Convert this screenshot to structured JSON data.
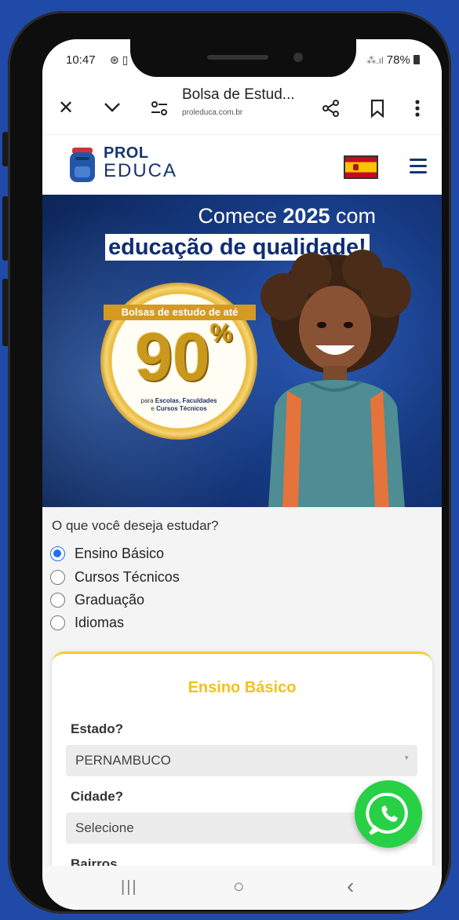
{
  "status_bar": {
    "time": "10:47",
    "status_icons": "⊛ ▯",
    "battery": "78%",
    "signal": "⁂.ıl"
  },
  "browser": {
    "close_icon": "close-icon",
    "dropdown_icon": "chevron-down-icon",
    "site_settings_icon": "tune-icon",
    "title": "Bolsa de Estud...",
    "url": "proleduca.com.br",
    "share_icon": "share-icon",
    "bookmark_icon": "bookmark-icon",
    "menu_icon": "more-vert-icon"
  },
  "site_header": {
    "logo_line1": "PROL",
    "logo_line2": "EDUCA",
    "language_flag": "spain-flag-icon",
    "menu_icon": "hamburger-icon"
  },
  "banner": {
    "line1_pre": "Comece ",
    "line1_bold": "2025",
    "line1_post": " com",
    "line2": "educação de qualidade!",
    "medal_ribbon": "Bolsas de estudo de até",
    "medal_value": "90",
    "medal_percent": "%",
    "medal_small_pre": "para ",
    "medal_small_bold1": "Escolas, Faculdades",
    "medal_small_mid": "e ",
    "medal_small_bold2": "Cursos Técnicos"
  },
  "study_options": {
    "question": "O que você deseja estudar?",
    "options": [
      {
        "label": "Ensino Básico",
        "checked": true
      },
      {
        "label": "Cursos Técnicos",
        "checked": false
      },
      {
        "label": "Graduação",
        "checked": false
      },
      {
        "label": "Idiomas",
        "checked": false
      }
    ]
  },
  "form": {
    "title": "Ensino Básico",
    "state_label": "Estado?",
    "state_value": "PERNAMBUCO",
    "city_label": "Cidade?",
    "city_placeholder": "Selecione",
    "neighborhood_label": "Bairros"
  },
  "floating": {
    "whatsapp_icon": "whatsapp-icon"
  },
  "nav_bar": {
    "recents": "|||",
    "home": "○",
    "back": "‹"
  },
  "colors": {
    "background_blue": "#1f4aa8",
    "accent_yellow": "#f2c21a",
    "brand_navy": "#17356d",
    "radio_blue": "#1a73e8",
    "whatsapp_green": "#27d044"
  }
}
